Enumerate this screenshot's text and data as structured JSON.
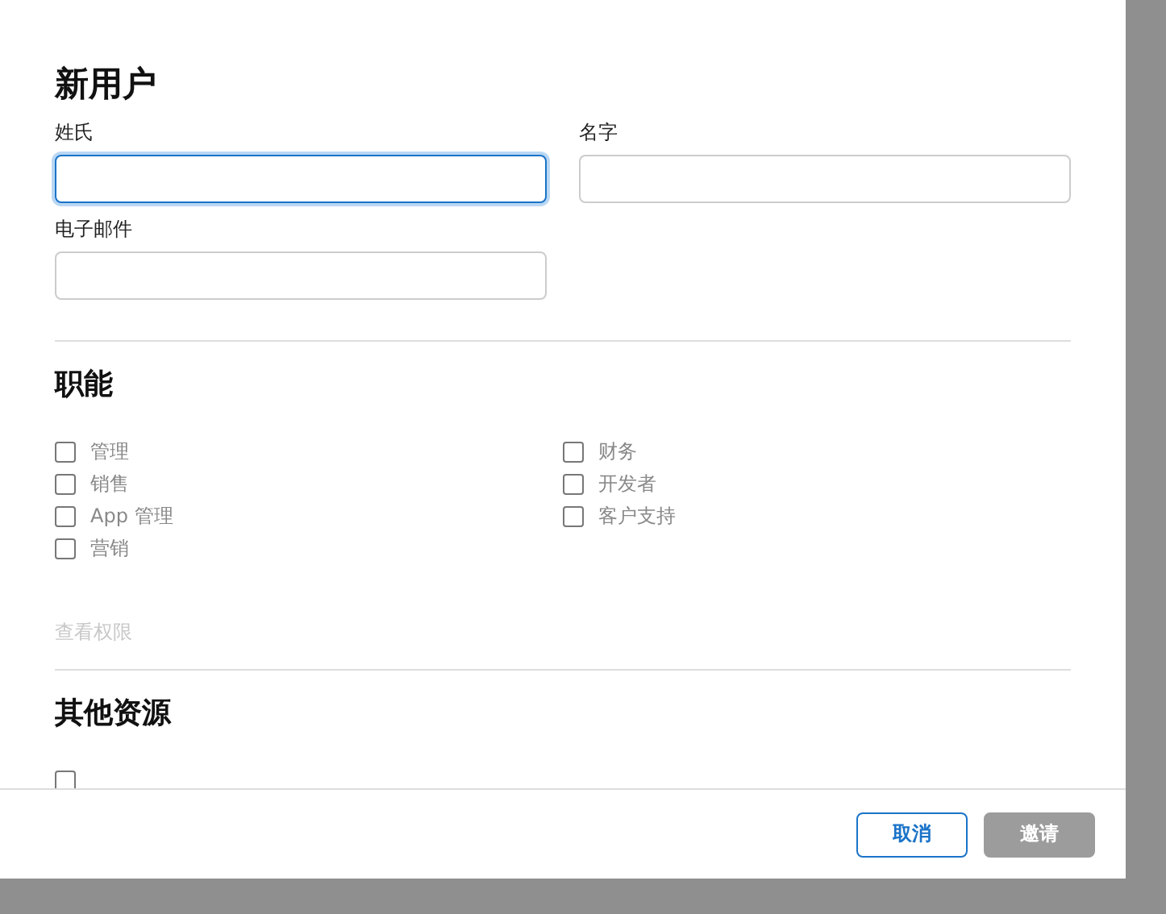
{
  "dialog": {
    "title": "新用户",
    "fields": [
      {
        "label": "姓氏",
        "focused": true
      },
      {
        "label": "名字",
        "focused": false
      },
      {
        "label": "电子邮件",
        "focused": false
      }
    ],
    "roles_section": {
      "title": "职能",
      "left": [
        {
          "label": "管理",
          "checked": false
        },
        {
          "label": "销售",
          "checked": false
        },
        {
          "label": "App 管理",
          "checked": false
        },
        {
          "label": "营销",
          "checked": false
        }
      ],
      "right": [
        {
          "label": "财务",
          "checked": false
        },
        {
          "label": "开发者",
          "checked": false
        },
        {
          "label": "客户支持",
          "checked": false
        }
      ],
      "link": "查看权限"
    },
    "other_section": {
      "title": "其他资源",
      "items": [
        {
          "checked": false
        }
      ]
    },
    "buttons": [
      {
        "label": "取消",
        "kind": "secondary",
        "disabled": false
      },
      {
        "label": "邀请",
        "kind": "primary",
        "disabled": true
      }
    ]
  }
}
